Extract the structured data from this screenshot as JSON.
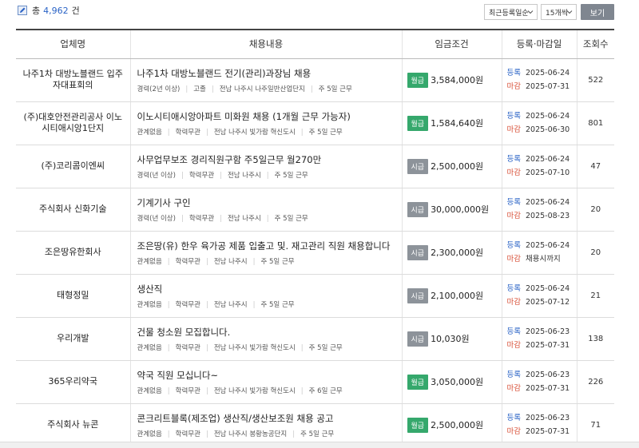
{
  "header": {
    "total_prefix": "총",
    "total_count": "4,962",
    "total_suffix": "건",
    "sort_select": "최근등록일순",
    "count_select": "15개씩",
    "view_button": "보기"
  },
  "table": {
    "columns": [
      "업체명",
      "채용내용",
      "임금조건",
      "등록·마감일",
      "조회수"
    ],
    "registered_label": "등록",
    "deadline_label": "마감",
    "rows": [
      {
        "company": "나주1차 대방노블랜드 입주자대표회의",
        "title": "나주1차 대방노블랜드 전기(관리)과장님 채용",
        "meta": [
          "경력(2년 이상)",
          "고졸",
          "전남 나주시 나주일반산업단지",
          "주 5일 근무"
        ],
        "pay_type": "월급",
        "pay_kind": "monthly",
        "pay": "3,584,000원",
        "registered": "2025-06-24",
        "deadline": "2025-07-31",
        "views": "522"
      },
      {
        "company": "(주)대호안전관리공사 이노시티애시앙1단지",
        "title": "이노시티애시앙아파트 미화원 채용 (1개월 근무 가능자)",
        "meta": [
          "관계없음",
          "학력무관",
          "전남 나주시 빛가람 혁신도시",
          "주 5일 근무"
        ],
        "pay_type": "월급",
        "pay_kind": "monthly",
        "pay": "1,584,640원",
        "registered": "2025-06-24",
        "deadline": "2025-06-30",
        "views": "801"
      },
      {
        "company": "(주)코리콤이엔씨",
        "title": "사무업무보조 경리직원구함 주5일근무 월270만",
        "meta": [
          "경력(년 이상)",
          "학력무관",
          "전남 나주시",
          "주 5일 근무"
        ],
        "pay_type": "시급",
        "pay_kind": "hourly",
        "pay": "2,500,000원",
        "registered": "2025-06-24",
        "deadline": "2025-07-10",
        "views": "47"
      },
      {
        "company": "주식회사 신화기술",
        "title": "기계기사 구인",
        "meta": [
          "경력(년 이상)",
          "학력무관",
          "전남 나주시",
          "주 5일 근무"
        ],
        "pay_type": "시급",
        "pay_kind": "hourly",
        "pay": "30,000,000원",
        "registered": "2025-06-24",
        "deadline": "2025-08-23",
        "views": "20"
      },
      {
        "company": "조은땅유한회사",
        "title": "조은땅(유) 한우 육가공 제품 입출고 및. 재고관리 직원 채용합니다",
        "meta": [
          "관계없음",
          "학력무관",
          "전남 나주시",
          "주 5일 근무"
        ],
        "pay_type": "시급",
        "pay_kind": "hourly",
        "pay": "2,300,000원",
        "registered": "2025-06-24",
        "deadline": "채용시까지",
        "views": "20"
      },
      {
        "company": "태형정밀",
        "title": "생산직",
        "meta": [
          "관계없음",
          "학력무관",
          "전남 나주시",
          "주 5일 근무"
        ],
        "pay_type": "시급",
        "pay_kind": "hourly",
        "pay": "2,100,000원",
        "registered": "2025-06-24",
        "deadline": "2025-07-12",
        "views": "21"
      },
      {
        "company": "우리개발",
        "title": "건물 청소원 모집합니다.",
        "meta": [
          "관계없음",
          "학력무관",
          "전남 나주시 빛가람 혁신도시",
          "주 5일 근무"
        ],
        "pay_type": "시급",
        "pay_kind": "hourly",
        "pay": "10,030원",
        "registered": "2025-06-23",
        "deadline": "2025-07-31",
        "views": "138"
      },
      {
        "company": "365우리약국",
        "title": "약국 직원 모십니다~",
        "meta": [
          "관계없음",
          "학력무관",
          "전남 나주시 빛가람 혁신도시",
          "주 6일 근무"
        ],
        "pay_type": "월급",
        "pay_kind": "monthly",
        "pay": "3,050,000원",
        "registered": "2025-06-23",
        "deadline": "2025-07-31",
        "views": "226"
      },
      {
        "company": "주식회사 뉴콘",
        "title": "콘크리트블록(제조업) 생산직/생산보조원 채용 공고",
        "meta": [
          "관계없음",
          "학력무관",
          "전남 나주시 봉황농공단지",
          "주 5일 근무"
        ],
        "pay_type": "월급",
        "pay_kind": "monthly",
        "pay": "2,500,000원",
        "registered": "2025-06-23",
        "deadline": "2025-07-31",
        "views": "71"
      }
    ]
  },
  "colors": {
    "accent_blue": "#2a63c6",
    "deadline_red": "#d9533b",
    "monthly_green": "#35a86c",
    "hourly_gray": "#8d939a"
  }
}
